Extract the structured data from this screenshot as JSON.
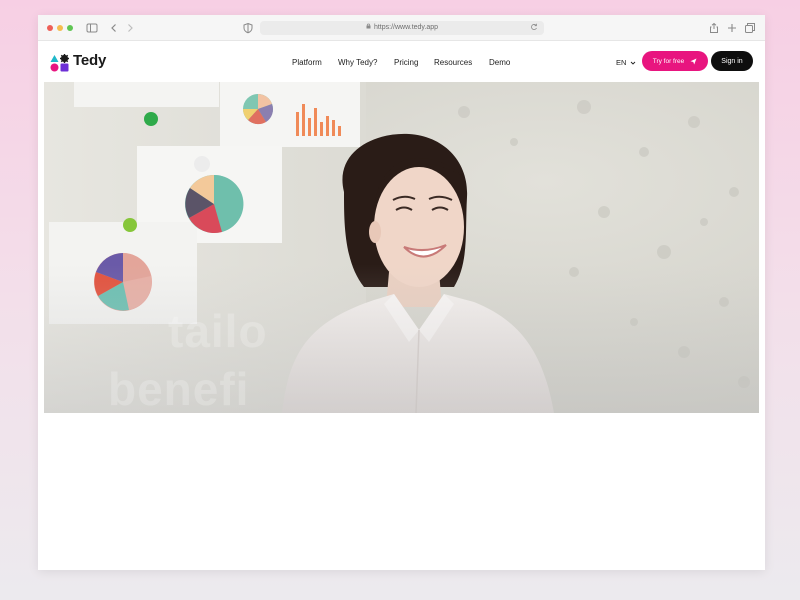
{
  "browser": {
    "url": "https://www.tedy.app",
    "icons": [
      "sidebar-icon",
      "back-chevron-icon",
      "forward-chevron-icon",
      "shield-icon",
      "reload-icon",
      "share-icon",
      "new-tab-plus-icon",
      "tabs-overview-icon",
      "lock-icon"
    ]
  },
  "header": {
    "logo_text": "Tedy",
    "nav": [
      {
        "label": "Platform"
      },
      {
        "label": "Why Tedy?"
      },
      {
        "label": "Pricing"
      },
      {
        "label": "Resources"
      },
      {
        "label": "Demo"
      }
    ],
    "language": "EN",
    "try_label": "Try for free",
    "signin_label": "Sign in"
  },
  "hero": {
    "overlay_lines": [
      "tailo",
      "benefi"
    ]
  },
  "colors": {
    "accent": "#e8157f",
    "dark_button": "#0e0e0e",
    "page_bg_top": "#f7cfe4",
    "page_bg_bottom": "#eceaee"
  }
}
